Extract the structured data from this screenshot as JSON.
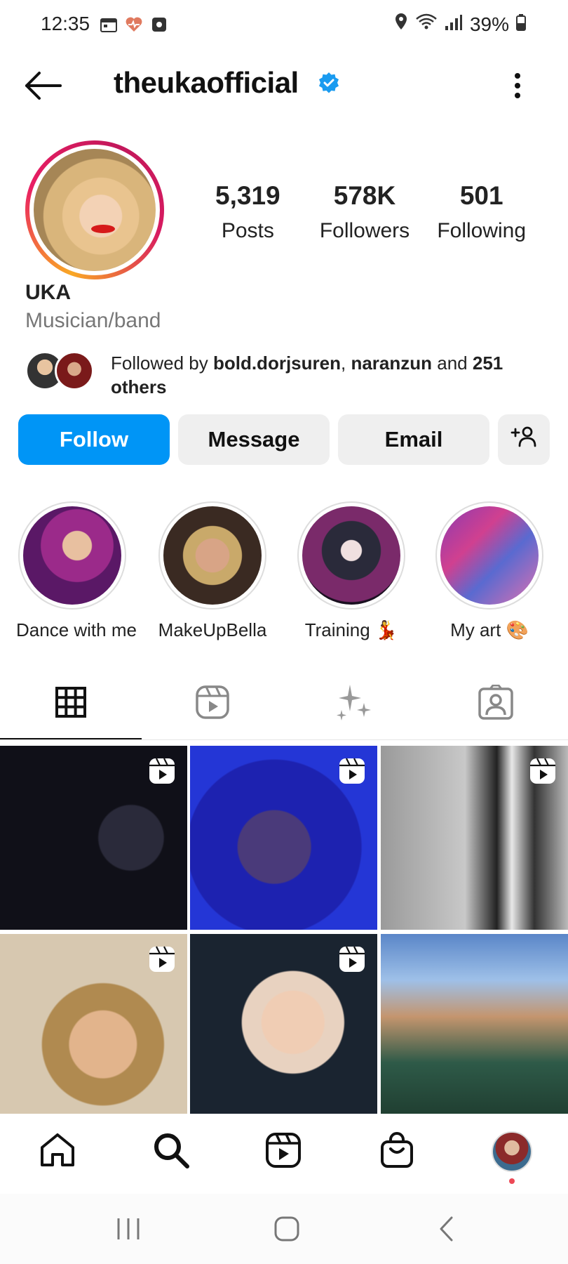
{
  "status_bar": {
    "time": "12:35",
    "battery": "39%",
    "icons": [
      "calendar-icon",
      "health-heart-icon",
      "square-app-icon",
      "location-icon",
      "wifi-icon",
      "signal-icon",
      "battery-icon"
    ]
  },
  "header": {
    "username": "theukaofficial",
    "verified": true,
    "back_icon": "arrow-left-icon",
    "more_icon": "vertical-dots-icon"
  },
  "profile": {
    "stats": [
      {
        "value": "5,319",
        "label": "Posts"
      },
      {
        "value": "578K",
        "label": "Followers"
      },
      {
        "value": "501",
        "label": "Following"
      }
    ],
    "name": "UKA",
    "category": "Musician/band",
    "followed_by": {
      "prefix": "Followed by",
      "user1": "bold.dorjsuren",
      "sep": ",",
      "user2": "naranzun",
      "and_text": "and",
      "count": "251",
      "suffix": "others"
    }
  },
  "actions": {
    "follow": "Follow",
    "message": "Message",
    "email": "Email",
    "add_user_icon": "add-person-icon"
  },
  "highlights": [
    {
      "label": "Dance with me"
    },
    {
      "label": "MakeUpBella"
    },
    {
      "label": "Training 💃"
    },
    {
      "label": "My art 🎨"
    }
  ],
  "tabs": [
    "grid-icon",
    "reels-icon",
    "sparkles-icon",
    "tagged-person-icon"
  ],
  "grid": {
    "reel_icon": "reel-play-icon"
  },
  "bottom_nav": [
    "home-icon",
    "search-icon",
    "reels-icon",
    "shop-bag-icon",
    "profile-avatar"
  ],
  "system_nav": [
    "recents-icon",
    "home-circle-icon",
    "back-chevron-icon"
  ],
  "colors": {
    "follow_blue": "#0095f6",
    "button_gray": "#efefef",
    "verified_blue": "#1a9bf0",
    "notification_dot": "#ed4956"
  }
}
